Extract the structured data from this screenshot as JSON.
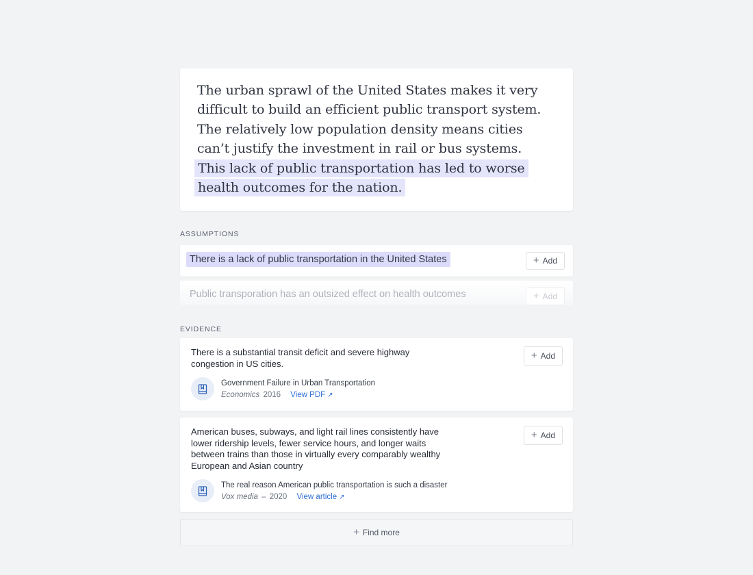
{
  "passage": {
    "plain": "The urban sprawl of the United States makes it very difficult to build an efficient public transport system. The relatively low population density means cities can’t justify the investment in rail or bus systems.",
    "highlighted": "This lack of public transportation has led to worse health outcomes for the nation."
  },
  "assumptions": {
    "label": "ASSUMPTIONS",
    "items": [
      {
        "text": "There is a lack of public transportation in the United States",
        "add_label": "Add"
      },
      {
        "text": "Public transporation has an outsized effect on health outcomes",
        "add_label": "Add"
      }
    ]
  },
  "evidence": {
    "label": "EVIDENCE",
    "items": [
      {
        "quote": "There is a substantial transit deficit and severe highway congestion in US cities.",
        "add_label": "Add",
        "source_title": "Government Failure in Urban Transportation",
        "publication": "Economics",
        "separator": "",
        "year": "2016",
        "link_label": "View PDF",
        "link_arrow": "↗"
      },
      {
        "quote": "American buses, subways, and light rail lines consistently have lower ridership levels, fewer service hours, and longer waits between trains than those in virtually every comparably wealthy European and Asian country",
        "add_label": "Add",
        "source_title": "The real reason American public transportation is such a disaster",
        "publication": "Vox media",
        "separator": "–",
        "year": "2020",
        "link_label": "View article",
        "link_arrow": "↗"
      }
    ]
  },
  "find_more": {
    "label": "Find more"
  },
  "icons": {
    "add": "plus-icon",
    "source": "book-bookmark-icon",
    "link": "external-arrow-icon"
  },
  "colors": {
    "highlight": "#e4e4fb",
    "assumption_highlight": "#dcdcfa",
    "link": "#2f6fd6",
    "background": "#f2f3f5"
  }
}
